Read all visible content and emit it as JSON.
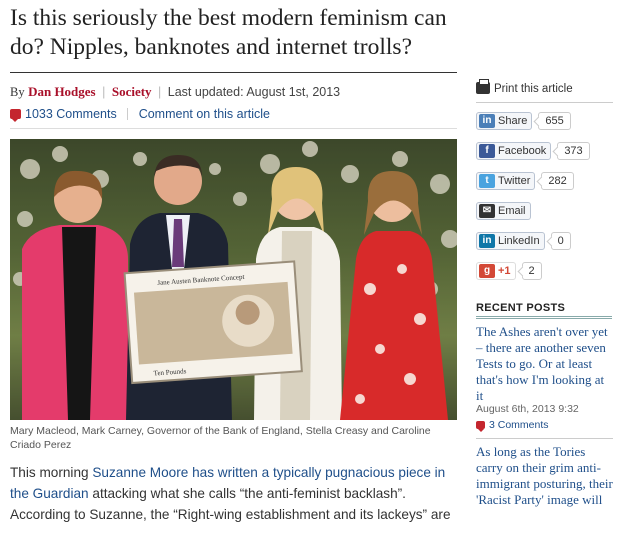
{
  "article": {
    "headline": "Is this seriously the best modern feminism can do? Nipples, banknotes and internet trolls?",
    "by": "By",
    "author": "Dan Hodges",
    "section": "Society",
    "last_updated": "Last updated: August 1st, 2013",
    "comment_count": "1033 Comments",
    "comment_link": "Comment on this article",
    "photo_caption": "Mary Macleod, Mark Carney, Governor of the Bank of England, Stella Creasy and Caroline Criado Perez",
    "banknote_text": {
      "top": "Jane Austen Banknote Concept",
      "bottom": "Ten Pounds"
    },
    "body": {
      "t1": "This morning ",
      "l1": "Suzanne Moore has written a typically pugnacious piece in the Guardian",
      "t2": " attacking what she calls “the anti-feminist backlash”. According to Suzanne, the “Right-wing establishment and its lackeys” are"
    }
  },
  "sidebar": {
    "print": "Print this article",
    "share": [
      {
        "label": "Share",
        "count": "655",
        "icon": "linkedin-share-icon",
        "color": "#4b7fb8"
      },
      {
        "label": "Facebook",
        "count": "373",
        "icon": "facebook-icon",
        "color": "#3b5998"
      },
      {
        "label": "Twitter",
        "count": "282",
        "icon": "twitter-icon",
        "color": "#4aa3df"
      },
      {
        "label": "Email",
        "count": "",
        "icon": "email-icon",
        "color": "#333333"
      },
      {
        "label": "LinkedIn",
        "count": "0",
        "icon": "linkedin-icon",
        "color": "#0e76a8"
      },
      {
        "label": "+1",
        "count": "2",
        "icon": "google-plus-icon",
        "color": "#d34836"
      }
    ],
    "recent_heading": "RECENT POSTS",
    "recent": [
      {
        "title": "The Ashes aren't over yet – there are another seven Tests to go. Or at least that's how I'm looking at it",
        "date": "August 6th, 2013 9:32",
        "comments": "3 Comments"
      },
      {
        "title": "As long as the Tories carry on their grim anti-immigrant posturing, their 'Racist Party' image will",
        "date": "",
        "comments": ""
      }
    ]
  },
  "colors": {
    "accent": "#a9102a",
    "link": "#1f4f8a"
  }
}
